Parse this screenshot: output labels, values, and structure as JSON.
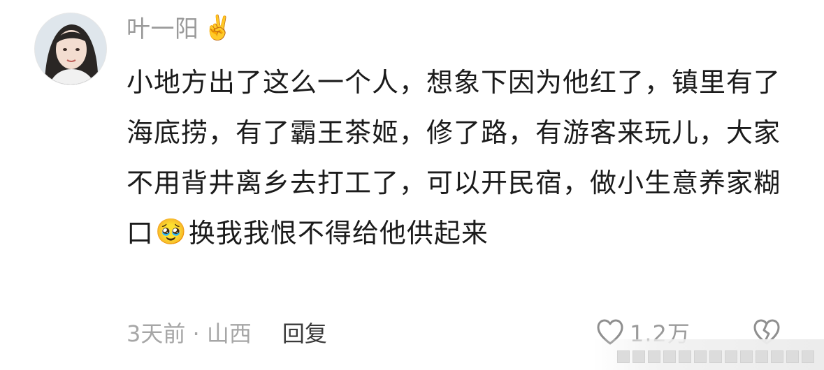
{
  "comment": {
    "user": {
      "name": "叶一阳",
      "badge_emoji": "✌️",
      "avatar_icon": "user-avatar"
    },
    "content": {
      "part1": "小地方出了这么一个人，想象下因为他红了，镇里有了海底捞，有了霸王茶姬，修了路，有游客来玩儿，大家不用背井离乡去打工了，可以开民宿，做小生意养家糊口",
      "emoji": "🥹",
      "part2": "换我我恨不得给他供起来"
    },
    "meta": {
      "time_location": "3天前 · 山西",
      "reply_label": "回复"
    },
    "actions": {
      "like_icon": "heart-outline-icon",
      "like_count": "1.2万",
      "dislike_icon": "broken-heart-icon"
    }
  }
}
